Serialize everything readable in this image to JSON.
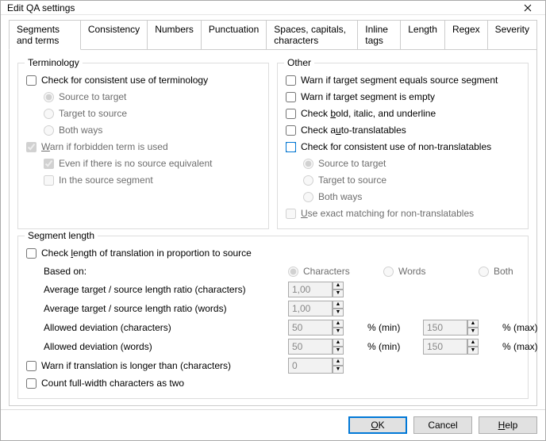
{
  "title": "Edit QA settings",
  "tabs": [
    "Segments and terms",
    "Consistency",
    "Numbers",
    "Punctuation",
    "Spaces, capitals, characters",
    "Inline tags",
    "Length",
    "Regex",
    "Severity"
  ],
  "terminology": {
    "title": "Terminology",
    "check_consistent": "Check for consistent use of terminology",
    "src_to_tgt": "Source to target",
    "tgt_to_src": "Target to source",
    "both_ways": "Both ways",
    "warn_forbidden_pre": "W",
    "warn_forbidden_post": "arn if forbidden term is used",
    "even_if_no_src": "Even if there is no source equivalent",
    "in_source_seg": "In the source segment"
  },
  "other": {
    "title": "Other",
    "warn_eq": "Warn if target segment equals source segment",
    "warn_empty": "Warn if target segment is empty",
    "check_bold_pre": "Check ",
    "check_bold_u": "b",
    "check_bold_post": "old, italic, and underline",
    "check_auto_pre": "Check a",
    "check_auto_u": "u",
    "check_auto_post": "to-translatables",
    "check_nontrans": "Check for consistent use of non-translatables",
    "src_to_tgt": "Source to target",
    "tgt_to_src": "Target to source",
    "both_ways": "Both ways",
    "use_exact_pre": "U",
    "use_exact_post": "se exact matching for non-translatables"
  },
  "seglen": {
    "title": "Segment length",
    "check_len_pre": "Check ",
    "check_len_u": "l",
    "check_len_post": "ength of translation in proportion to source",
    "based_on": "Based on:",
    "characters": "Characters",
    "words": "Words",
    "both": "Both",
    "avg_chars": "Average target / source length ratio (characters)",
    "avg_words": "Average target / source length ratio (words)",
    "dev_chars": "Allowed deviation (characters)",
    "dev_words": "Allowed deviation (words)",
    "pct_min": "% (min)",
    "pct_max": "% (max)",
    "warn_longer": "Warn if translation is longer than (characters)",
    "count_full": "Count full-width characters as two",
    "val_ratio_chars": "1,00",
    "val_ratio_words": "1,00",
    "val_dev_chars_min": "50",
    "val_dev_chars_max": "150",
    "val_dev_words_min": "50",
    "val_dev_words_max": "150",
    "val_longer": "0"
  },
  "buttons": {
    "ok_u": "O",
    "ok_post": "K",
    "cancel": "Cancel",
    "help_u": "H",
    "help_post": "elp"
  }
}
